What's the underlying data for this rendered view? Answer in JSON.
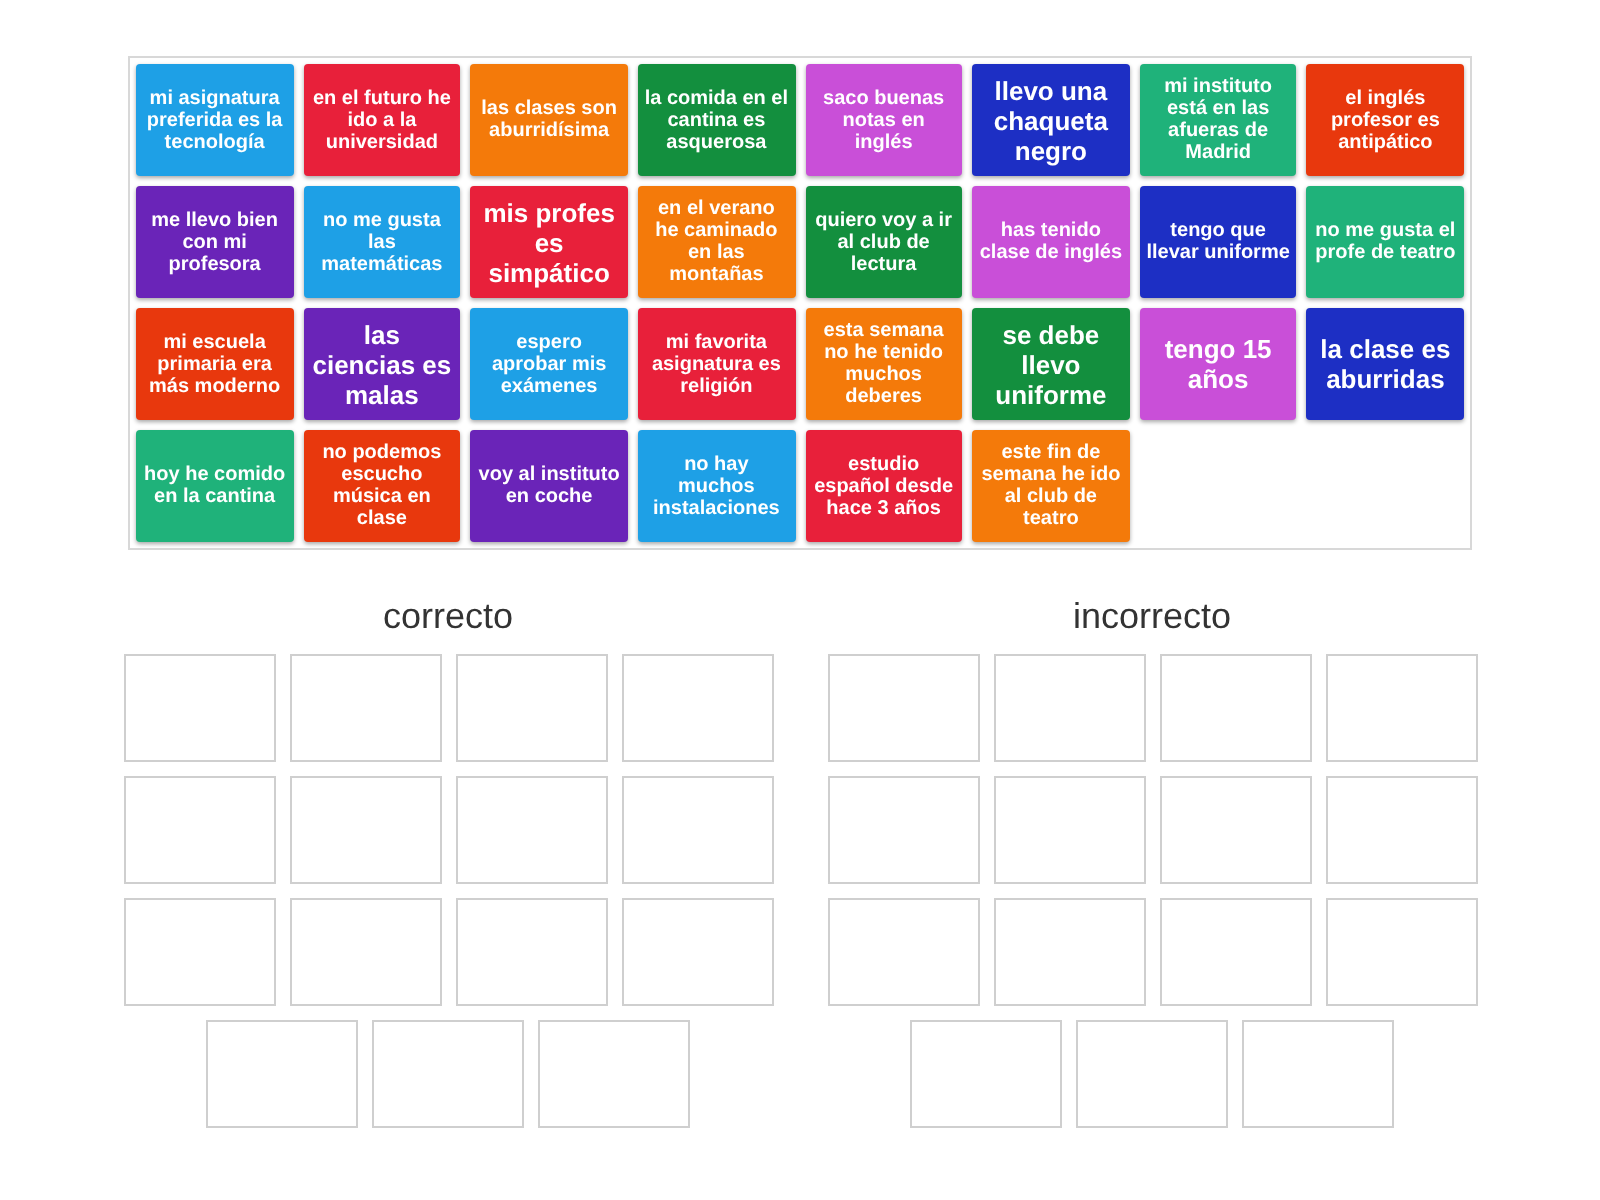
{
  "tiles": [
    {
      "text": "mi asignatura preferida es la tecnología",
      "color": "#1ea0e6"
    },
    {
      "text": "en el futuro he ido a la universidad",
      "color": "#e8203a"
    },
    {
      "text": "las clases son aburridísima",
      "color": "#f47a0a"
    },
    {
      "text": "la comida en el cantina es asquerosa",
      "color": "#138f3e"
    },
    {
      "text": "saco buenas notas en inglés",
      "color": "#c94fd8"
    },
    {
      "text": "llevo una chaqueta negro",
      "color": "#1d2fc4"
    },
    {
      "text": "mi instituto está en las afueras de Madrid",
      "color": "#1fb27a"
    },
    {
      "text": "el inglés profesor es antipático",
      "color": "#e8380d"
    },
    {
      "text": "me llevo bien con mi profesora",
      "color": "#6a24b8"
    },
    {
      "text": "no me gusta las matemáticas",
      "color": "#1ea0e6"
    },
    {
      "text": "mis profes es simpático",
      "color": "#e8203a"
    },
    {
      "text": "en el verano he caminado en las montañas",
      "color": "#f47a0a"
    },
    {
      "text": "quiero voy a ir al club de lectura",
      "color": "#138f3e"
    },
    {
      "text": "has tenido clase de inglés",
      "color": "#c94fd8"
    },
    {
      "text": "tengo que llevar uniforme",
      "color": "#1d2fc4"
    },
    {
      "text": "no me gusta el profe de teatro",
      "color": "#1fb27a"
    },
    {
      "text": "mi escuela primaria era más moderno",
      "color": "#e8380d"
    },
    {
      "text": "las ciencias es malas",
      "color": "#6a24b8"
    },
    {
      "text": "espero aprobar mis exámenes",
      "color": "#1ea0e6"
    },
    {
      "text": "mi favorita asignatura es religión",
      "color": "#e8203a"
    },
    {
      "text": "esta semana no he tenido muchos deberes",
      "color": "#f47a0a"
    },
    {
      "text": "se debe llevo uniforme",
      "color": "#138f3e"
    },
    {
      "text": "tengo 15 años",
      "color": "#c94fd8"
    },
    {
      "text": "la clase es aburridas",
      "color": "#1d2fc4"
    },
    {
      "text": "hoy he comido en la cantina",
      "color": "#1fb27a"
    },
    {
      "text": "no podemos escucho música en clase",
      "color": "#e8380d"
    },
    {
      "text": "voy al instituto en coche",
      "color": "#6a24b8"
    },
    {
      "text": "no hay muchos instalaciones",
      "color": "#1ea0e6"
    },
    {
      "text": "estudio español desde hace 3 años",
      "color": "#e8203a"
    },
    {
      "text": "este fin de semana he ido al club de teatro",
      "color": "#f47a0a"
    }
  ],
  "groups": [
    {
      "title": "correcto"
    },
    {
      "title": "incorrecto"
    }
  ]
}
